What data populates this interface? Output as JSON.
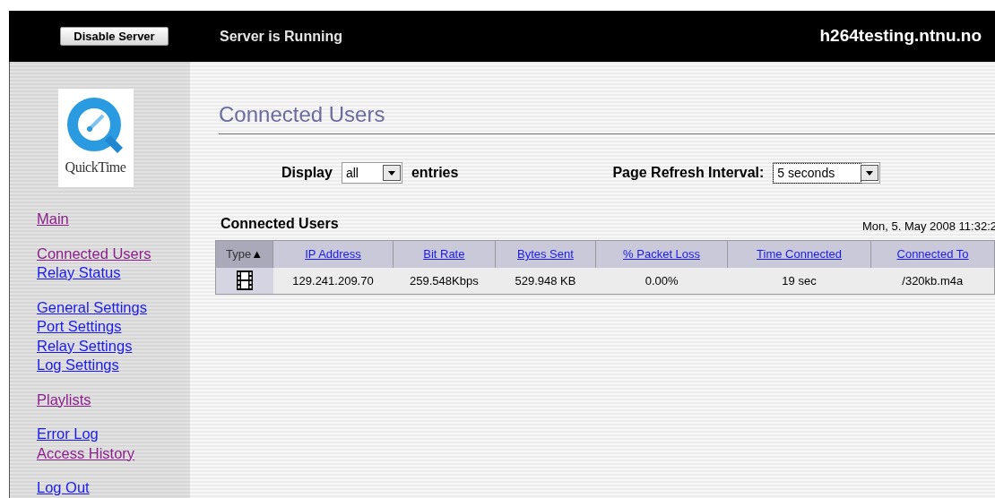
{
  "header": {
    "button": "Disable Server",
    "status": "Server is Running",
    "host": "h264testing.ntnu.no"
  },
  "logo": {
    "text": "QuickTime"
  },
  "nav_groups": [
    [
      {
        "label": "Main",
        "visited": true
      }
    ],
    [
      {
        "label": "Connected Users",
        "visited": true
      },
      {
        "label": "Relay Status",
        "visited": false
      }
    ],
    [
      {
        "label": "General Settings",
        "visited": false
      },
      {
        "label": "Port Settings",
        "visited": false
      },
      {
        "label": "Relay Settings",
        "visited": false
      },
      {
        "label": "Log Settings",
        "visited": false
      }
    ],
    [
      {
        "label": "Playlists",
        "visited": true
      }
    ],
    [
      {
        "label": "Error Log",
        "visited": false
      },
      {
        "label": "Access History",
        "visited": true
      }
    ],
    [
      {
        "label": "Log Out",
        "visited": false
      }
    ]
  ],
  "page_title": "Connected Users",
  "display": {
    "label": "Display",
    "value": "all",
    "suffix": "entries"
  },
  "refresh": {
    "label": "Page Refresh Interval:",
    "value": "5 seconds",
    "focused": true
  },
  "table": {
    "title": "Connected Users",
    "timestamp": "Mon, 5. May 2008 11:32:2",
    "columns": [
      {
        "label": "Type",
        "sorted": true,
        "sort_mark": "▲"
      },
      {
        "label": "IP Address",
        "sorted": false
      },
      {
        "label": "Bit Rate",
        "sorted": false
      },
      {
        "label": "Bytes Sent",
        "sorted": false
      },
      {
        "label": "% Packet Loss",
        "sorted": false
      },
      {
        "label": "Time Connected",
        "sorted": false
      },
      {
        "label": "Connected To",
        "sorted": false
      }
    ],
    "rows": [
      {
        "kind": "video",
        "cells": [
          "",
          "129.241.209.70",
          "259.548Kbps",
          "529.948 KB",
          "0.00%",
          "19 sec",
          "/320kb.m4a"
        ]
      }
    ]
  }
}
